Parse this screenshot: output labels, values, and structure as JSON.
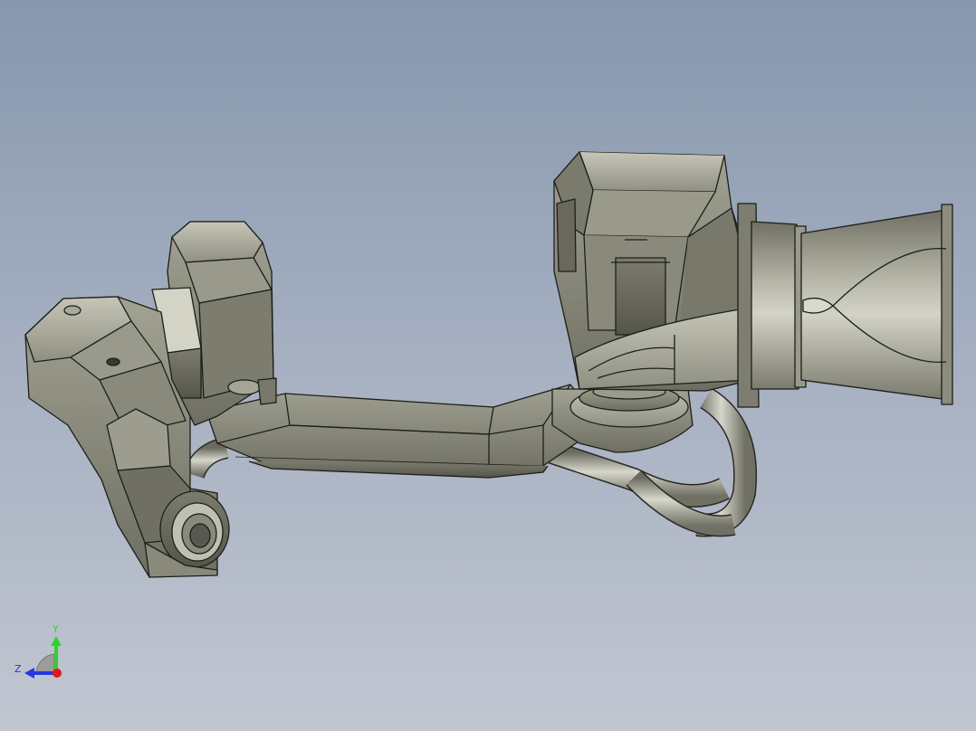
{
  "viewport": {
    "background_top": "#8797ad",
    "background_bottom": "#c1c6d1",
    "model_face_color": "#8a8a7c",
    "model_edge_color": "#1e1e1a"
  },
  "triad": {
    "y_label": "Y",
    "z_label": "Z",
    "y_color": "#2fd12f",
    "z_color": "#2438e0",
    "x_color": "#e01818"
  }
}
